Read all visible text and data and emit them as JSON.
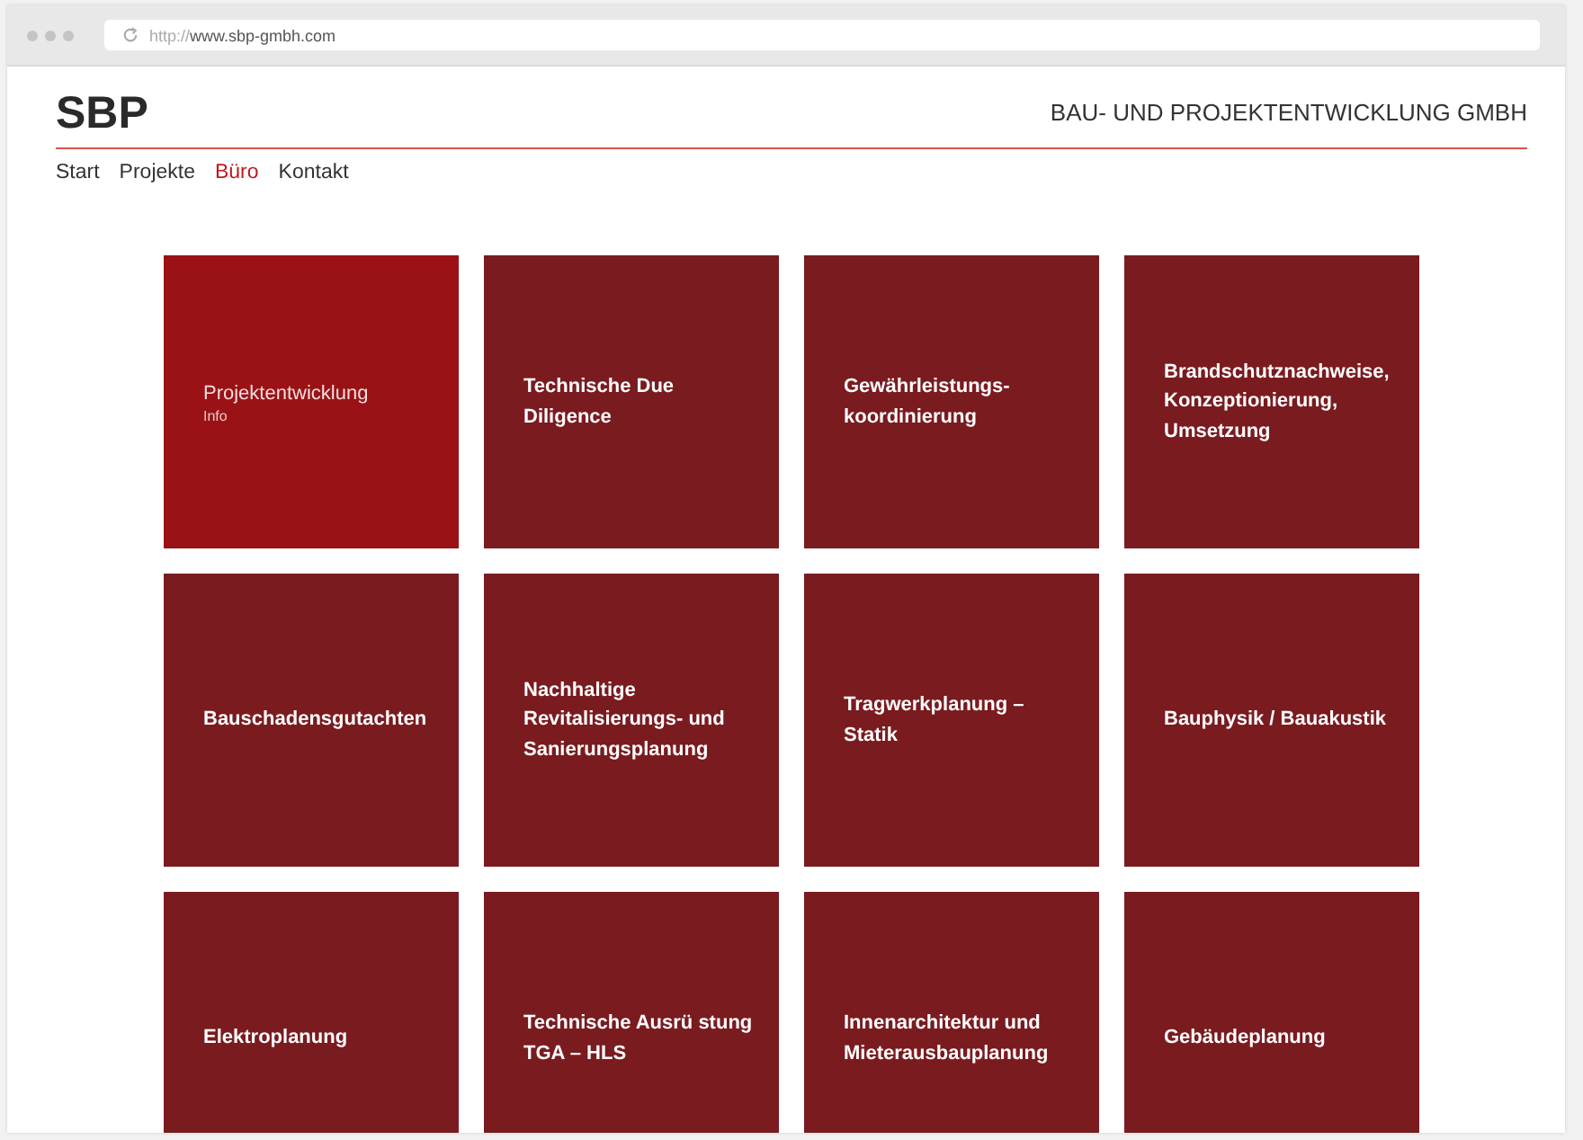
{
  "browser": {
    "url_prefix": "http://",
    "url_host": "www.sbp-gmbh.com"
  },
  "header": {
    "logo": "SBP",
    "tagline": "BAU- UND PROJEKTENTWICKLUNG GMBH"
  },
  "nav": [
    {
      "label": "Start",
      "selected": false
    },
    {
      "label": "Projekte",
      "selected": false
    },
    {
      "label": "Büro",
      "selected": true
    },
    {
      "label": "Kontakt",
      "selected": false
    }
  ],
  "tiles": [
    {
      "lines": [
        "Projektentwicklung"
      ],
      "subtitle": "Info",
      "selected": true
    },
    {
      "lines": [
        "Technische Due",
        "Diligence"
      ],
      "selected": false
    },
    {
      "lines": [
        "Gewährleistungs-",
        "koordinierung"
      ],
      "selected": false
    },
    {
      "lines": [
        "Brandschutznachweise,",
        "Konzeptionierung,",
        "Umsetzung"
      ],
      "selected": false
    },
    {
      "lines": [
        "Bauschadensgutachten"
      ],
      "selected": false
    },
    {
      "lines": [
        "Nachhaltige",
        "Revitalisierungs- und",
        "Sanierungsplanung"
      ],
      "selected": false
    },
    {
      "lines": [
        "Tragwerkplanung –",
        "Statik"
      ],
      "selected": false
    },
    {
      "lines": [
        "Bauphysik / Bauakustik"
      ],
      "selected": false
    },
    {
      "lines": [
        "Elektroplanung"
      ],
      "selected": false
    },
    {
      "lines": [
        "Technische Ausrü stung",
        "TGA – HLS"
      ],
      "selected": false
    },
    {
      "lines": [
        "Innenarchitektur und",
        "Mieterausbauplanung"
      ],
      "selected": false
    },
    {
      "lines": [
        "Gebäudeplanung"
      ],
      "selected": false
    }
  ]
}
